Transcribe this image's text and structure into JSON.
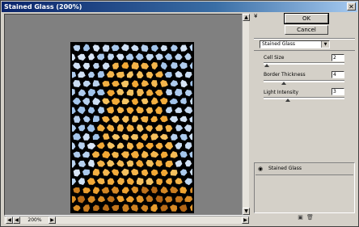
{
  "window": {
    "title": "Stained Glass (200%)"
  },
  "buttons": {
    "ok_label": "OK",
    "cancel_label": "Cancel"
  },
  "filter_select": {
    "value": "Stained Glass"
  },
  "params": [
    {
      "label": "Cell Size",
      "value": "2",
      "slider_fraction": 0.04
    },
    {
      "label": "Border Thickness",
      "value": "4",
      "slider_fraction": 0.25
    },
    {
      "label": "Light Intensity",
      "value": "3",
      "slider_fraction": 0.3
    }
  ],
  "layers": {
    "items": [
      {
        "name": "Stained Glass"
      }
    ]
  },
  "zoom": {
    "value": "200%"
  },
  "icons": {
    "close": "close-icon",
    "collapse": "double-chevron-down-icon",
    "eye": "eye-icon",
    "new_layer": "new-layer-icon",
    "delete": "trash-icon"
  },
  "colors": {
    "title_start": "#0a246a",
    "title_end": "#a6caf0",
    "sky": "#9fc2ea",
    "amber": "#f2a632",
    "dark_amber": "#a85a10",
    "leading": "#000000"
  }
}
